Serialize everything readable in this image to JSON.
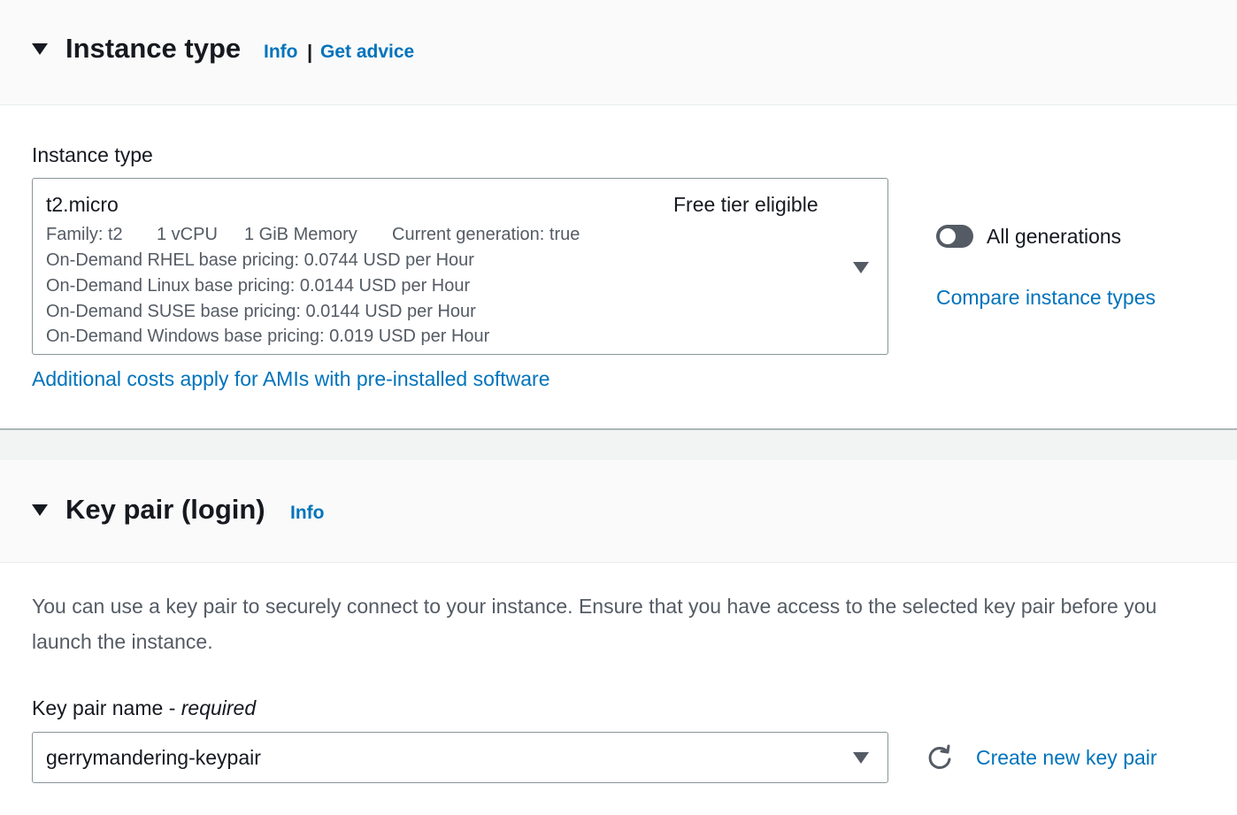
{
  "instance_type_section": {
    "title": "Instance type",
    "info": "Info",
    "separator": "|",
    "get_advice": "Get advice",
    "field_label": "Instance type",
    "selected": {
      "name": "t2.micro",
      "badge": "Free tier eligible",
      "family": "Family: t2",
      "vcpu": "1 vCPU",
      "memory": "1 GiB Memory",
      "generation": "Current generation: true",
      "pricing": [
        "On-Demand RHEL base pricing: 0.0744 USD per Hour",
        "On-Demand Linux base pricing: 0.0144 USD per Hour",
        "On-Demand SUSE base pricing: 0.0144 USD per Hour",
        "On-Demand Windows base pricing: 0.019 USD per Hour"
      ]
    },
    "all_generations_label": "All generations",
    "all_generations_on": false,
    "compare_link": "Compare instance types",
    "additional_costs_link": "Additional costs apply for AMIs with pre-installed software"
  },
  "key_pair_section": {
    "title": "Key pair (login)",
    "info": "Info",
    "description": "You can use a key pair to securely connect to your instance. Ensure that you have access to the selected key pair before you launch the instance.",
    "field_label": "Key pair name - ",
    "field_required": "required",
    "selected_value": "gerrymandering-keypair",
    "refresh_icon": "refresh-icon",
    "create_link": "Create new key pair"
  },
  "colors": {
    "link": "#0073bb",
    "text": "#16191f",
    "secondary_text": "#545b64",
    "header_bg": "#fafafa"
  }
}
